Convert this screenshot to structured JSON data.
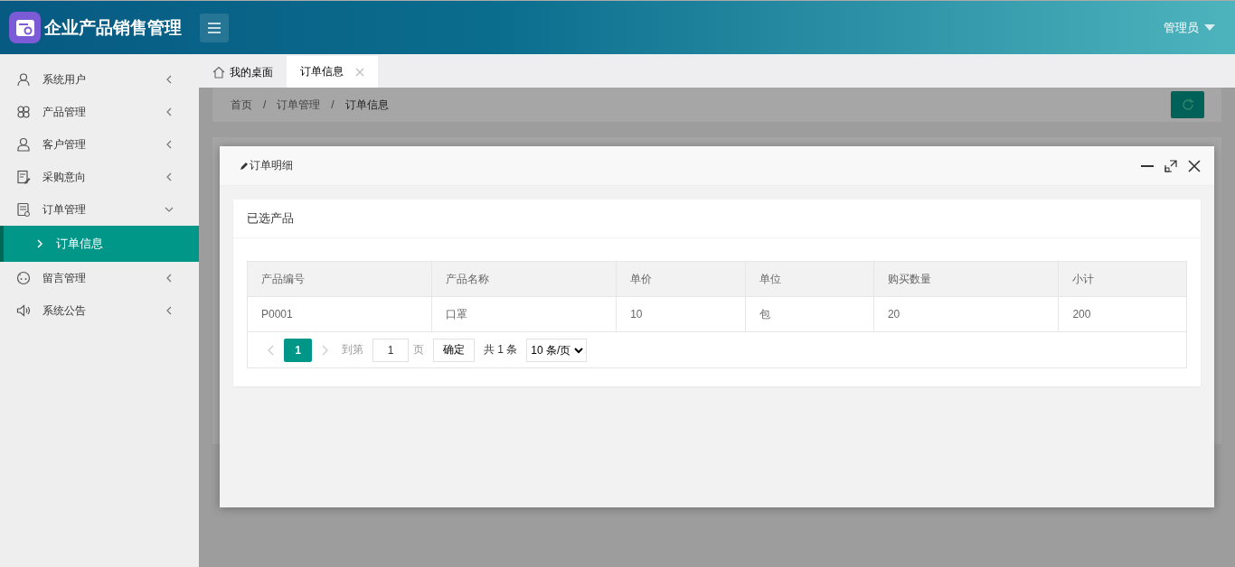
{
  "header": {
    "brand": "企业产品销售管理",
    "user": "管理员"
  },
  "sidebar": {
    "items": [
      {
        "label": "系统用户",
        "expanded": false
      },
      {
        "label": "产品管理",
        "expanded": false
      },
      {
        "label": "客户管理",
        "expanded": false
      },
      {
        "label": "采购意向",
        "expanded": false
      },
      {
        "label": "订单管理",
        "expanded": true,
        "children": [
          {
            "label": "订单信息",
            "selected": true
          }
        ]
      },
      {
        "label": "留言管理",
        "expanded": false
      },
      {
        "label": "系统公告",
        "expanded": false
      }
    ]
  },
  "tabs": [
    {
      "label": "我的桌面",
      "selected": false,
      "kind": "home"
    },
    {
      "label": "订单信息",
      "selected": true,
      "kind": "closable"
    }
  ],
  "breadcrumb": [
    "首页",
    "/",
    "订单管理",
    "/",
    "订单信息"
  ],
  "dialog": {
    "title": "订单明细",
    "card_title": "已选产品",
    "table": {
      "columns": [
        "产品编号",
        "产品名称",
        "单价",
        "单位",
        "购买数量",
        "小计"
      ],
      "rows": [
        [
          "P0001",
          "口罩",
          "10",
          "包",
          "20",
          "200"
        ]
      ]
    },
    "pagination": {
      "pages": [
        {
          "label": "1",
          "selected": true
        }
      ],
      "goto_label": "到第",
      "goto_value": "1",
      "page_unit": "页",
      "confirm": "确定",
      "total": "共 1 条",
      "page_size": "10 条/页"
    }
  }
}
